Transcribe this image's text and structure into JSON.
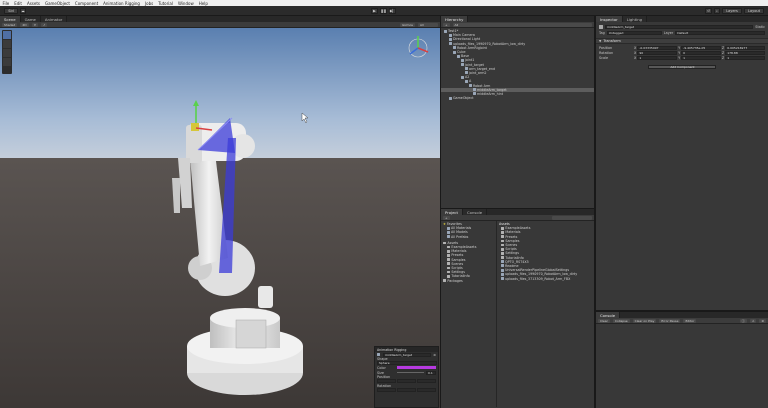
{
  "menu": [
    "File",
    "Edit",
    "Assets",
    "GameObject",
    "Component",
    "Animation Rigging",
    "Jobs",
    "Tutorial",
    "Window",
    "Help"
  ],
  "toolbar": {
    "account": "Sid",
    "play_glyph": "▶",
    "pause_glyph": "❚❚",
    "step_glyph": "▶▏",
    "layers": "Layers",
    "layout": "Layout"
  },
  "scene": {
    "tabs": [
      "Scene",
      "Game",
      "Animator"
    ],
    "toolbar_shading": "Shaded",
    "toolbar_mode": "2D",
    "toolbar_gizmos": "Gizmos",
    "toolbar_search": "All"
  },
  "hierarchy": {
    "tab": "Hierarchy",
    "search": "All",
    "rows": [
      "Test1*",
      "Main Camera",
      "Directional Light",
      "uploads_files_1990970_RobotArm_low_dirty",
      "Robot ArmRigJoint",
      "Cube",
      "Base",
      "joint1",
      "joint_target",
      "arm_target_end",
      "joint_arm2",
      "A2",
      "A",
      "Robot Arm",
      "middleArm_target",
      "middleArm_hint",
      "GameObject"
    ]
  },
  "inspector": {
    "tabs": [
      "Inspector",
      "Lighting"
    ],
    "object_name": "middleArm_target",
    "static_label": "Static",
    "tag_label": "Tag",
    "tag_value": "Untagged",
    "layer_label": "Layer",
    "layer_value": "Default",
    "transform_title": "Transform",
    "position_label": "Position",
    "rotation_label": "Rotation",
    "scale_label": "Scale",
    "position": [
      "-0.03335997",
      "-9.405735e-05",
      "0.005216977"
    ],
    "rotation": [
      "90",
      "0",
      "178.88"
    ],
    "scale": [
      "1",
      "1",
      "1"
    ],
    "add_component": "Add Component"
  },
  "project": {
    "tabs": [
      "Project",
      "Console"
    ],
    "favorites_label": "Favorites",
    "favorites": [
      "All Materials",
      "All Models",
      "All Prefabs"
    ],
    "assets_label": "Assets",
    "assets_tree": [
      "ExampleAssets",
      "Materials",
      "Presets",
      "Samples",
      "Scenes",
      "Scripts",
      "Settings",
      "TutorialInfo"
    ],
    "packages_label": "Packages",
    "breadcrumb": "Assets",
    "items": [
      "ExampleAssets",
      "Materials",
      "Presets",
      "Samples",
      "Scenes",
      "Scripts",
      "Settings",
      "TutorialInfo",
      "QPTO_RST4X5",
      "Readme",
      "UniversalRenderPipelineGlobalSettings",
      "uploads_files_1990970_RobotArm_low_dirty",
      "uploads_files_3713309_Robot_Arm_FBX"
    ]
  },
  "console": {
    "tab": "Console",
    "clear": "Clear",
    "collapse": "Collapse",
    "clear_on_play": "Clear on Play",
    "clear_on_build": "Error Pause",
    "editor": "Editor"
  },
  "overlay": {
    "title": "Animation Rigging",
    "target_value": "middleArm_target",
    "shape_label": "Shape",
    "shape_value": "Sphere",
    "color_label": "Color",
    "size_label": "Size",
    "size_value": "0.1",
    "position_label": "Position",
    "rotation_label": "Rotation"
  },
  "colors": {
    "accent_blue": "#3b3bd8",
    "gizmo_yellow": "#d6c63a",
    "gizmo_green": "#5ad14c"
  }
}
